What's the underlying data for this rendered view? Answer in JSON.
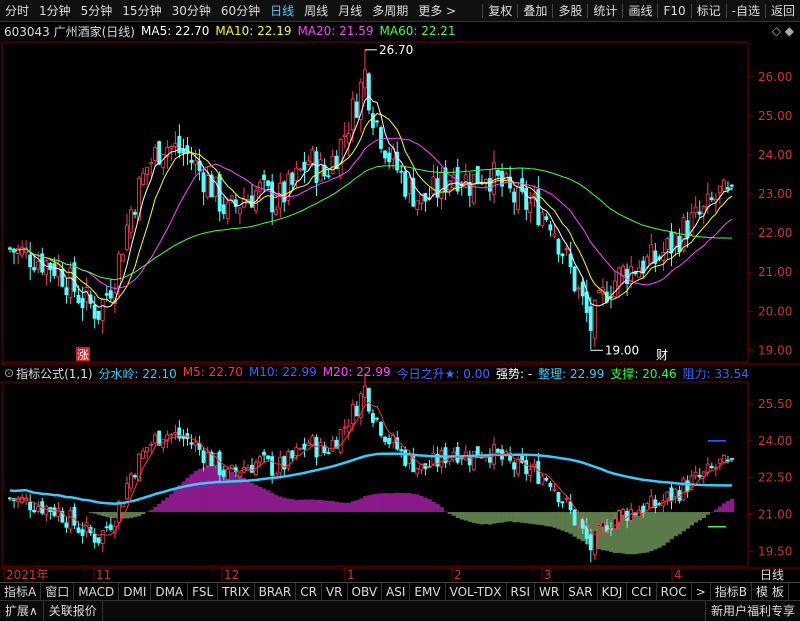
{
  "toolbar": {
    "periods": [
      "分时",
      "1分钟",
      "5分钟",
      "15分钟",
      "30分钟",
      "60分钟",
      "日线",
      "周线",
      "月线",
      "多周期"
    ],
    "active_period": "日线",
    "more": "更多",
    "more_arrow": ">",
    "right_items": [
      "复权",
      "叠加",
      "多股",
      "统计",
      "画线",
      "F10",
      "标记",
      "-自选",
      "返回"
    ]
  },
  "stock": {
    "code_name": "603043 广州酒家(日线)",
    "ma": [
      {
        "label": "MA5: 22.70",
        "color": "#ffffff"
      },
      {
        "label": "MA10: 22.19",
        "color": "#ffff00"
      },
      {
        "label": "MA20: 21.59",
        "color": "#ff44ff"
      },
      {
        "label": "MA60: 22.21",
        "color": "#44ff44"
      }
    ],
    "high_label": "26.70",
    "low_label": "19.00",
    "marker_zhang": "涨",
    "marker_cai": "财"
  },
  "price_axis": [
    "26.00",
    "25.00",
    "24.00",
    "23.00",
    "22.00",
    "21.00",
    "20.00",
    "19.00"
  ],
  "indicator": {
    "title": "指标公式(1,1)",
    "items": [
      {
        "label": "分水岭: 22.10",
        "color": "#33ccff"
      },
      {
        "label": "M5: 22.70",
        "color": "#ff3333"
      },
      {
        "label": "M10: 22.99",
        "color": "#3366ff"
      },
      {
        "label": "M20: 22.99",
        "color": "#ff44ff"
      },
      {
        "label": "今日之升★: 0.00",
        "color": "#4466ff"
      },
      {
        "label": "强势: -",
        "color": "#ffffff"
      },
      {
        "label": "整理: 22.99",
        "color": "#33ccff"
      },
      {
        "label": "支撑: 20.46",
        "color": "#33ff33"
      },
      {
        "label": "阻力: 33.54",
        "color": "#3366ff"
      }
    ]
  },
  "ind_axis": [
    "25.50",
    "24.00",
    "22.50",
    "21.00",
    "19.50"
  ],
  "date_axis": [
    "2021年",
    "11",
    "12",
    "1",
    "2",
    "3",
    "4"
  ],
  "date_axis_right": "日线",
  "tabs": [
    "指标A",
    "窗口",
    "MACD",
    "DMI",
    "DMA",
    "FSL",
    "TRIX",
    "BRAR",
    "CR",
    "VR",
    "OBV",
    "ASI",
    "EMV",
    "VOL-TDX",
    "RSI",
    "WR",
    "SAR",
    "KDJ",
    "CCI",
    "ROC",
    ">",
    "指标B",
    "模 板"
  ],
  "status": {
    "expand": "扩展∧",
    "related": "关联报价",
    "right": "新用户福利专享"
  },
  "colors": {
    "up": "#ff3c5a",
    "down": "#54ffff",
    "grid": "#7a0000",
    "accent": "#33ccff"
  }
}
